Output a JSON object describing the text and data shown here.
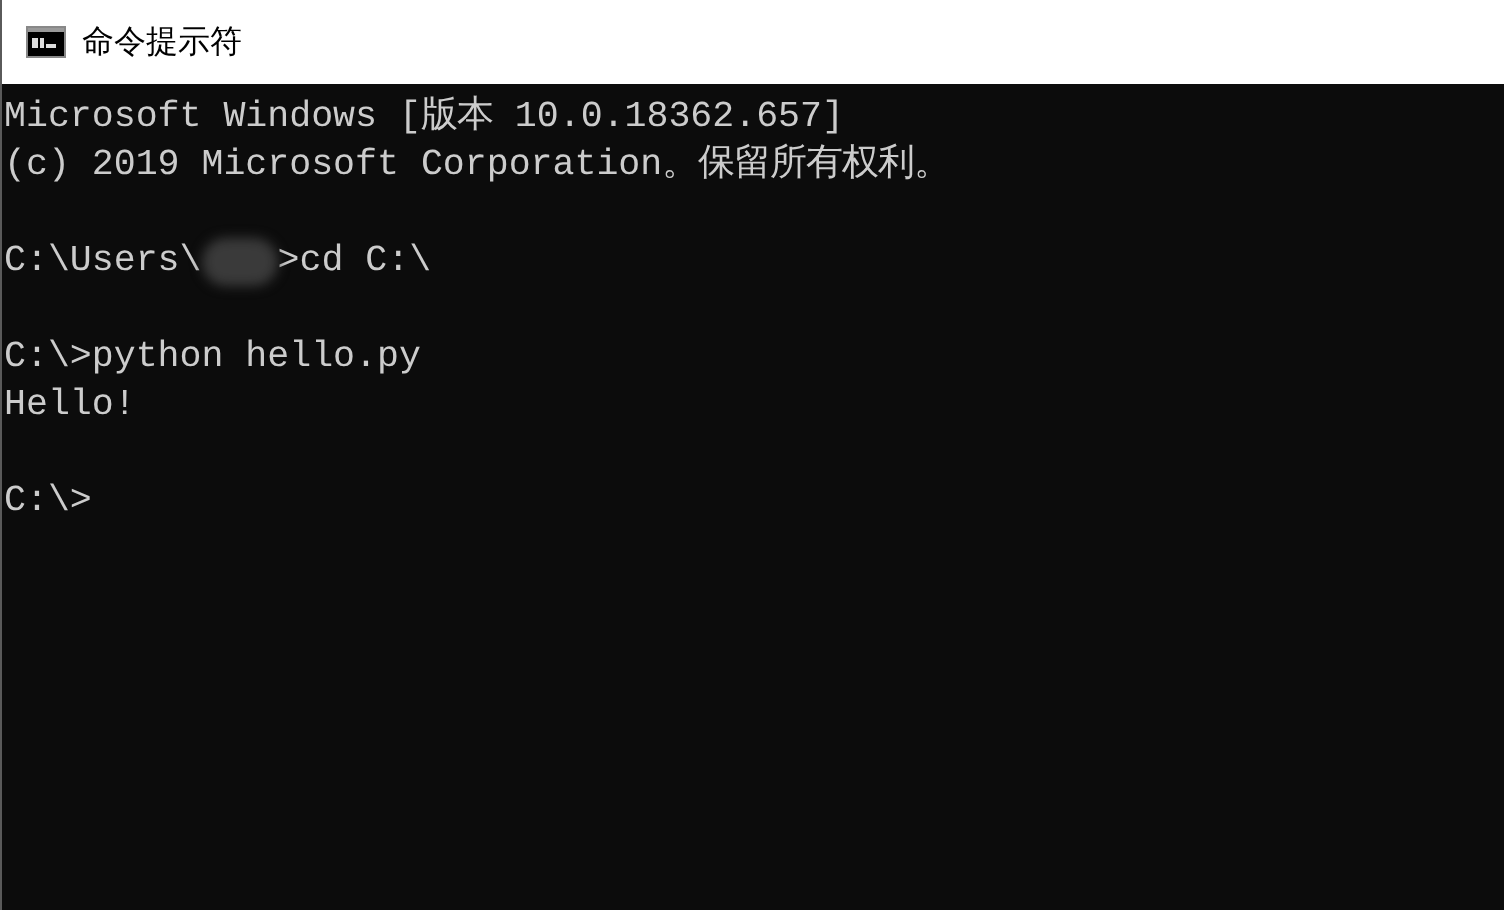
{
  "window": {
    "title": "命令提示符"
  },
  "console": {
    "lines": [
      {
        "kind": "text",
        "segments": [
          {
            "kind": "text",
            "text": "Microsoft Windows [版本 10.0.18362.657]"
          }
        ]
      },
      {
        "kind": "text",
        "segments": [
          {
            "kind": "text",
            "text": "(c) 2019 Microsoft Corporation。保留所有权利。"
          }
        ]
      },
      {
        "kind": "blank"
      },
      {
        "kind": "text",
        "segments": [
          {
            "kind": "text",
            "text": "C:\\Users\\"
          },
          {
            "kind": "redacted"
          },
          {
            "kind": "text",
            "text": ">cd C:\\"
          }
        ]
      },
      {
        "kind": "blank"
      },
      {
        "kind": "text",
        "segments": [
          {
            "kind": "text",
            "text": "C:\\>python hello.py"
          }
        ]
      },
      {
        "kind": "text",
        "segments": [
          {
            "kind": "text",
            "text": "Hello!"
          }
        ]
      },
      {
        "kind": "blank"
      },
      {
        "kind": "text",
        "segments": [
          {
            "kind": "text",
            "text": "C:\\>"
          }
        ]
      }
    ]
  }
}
